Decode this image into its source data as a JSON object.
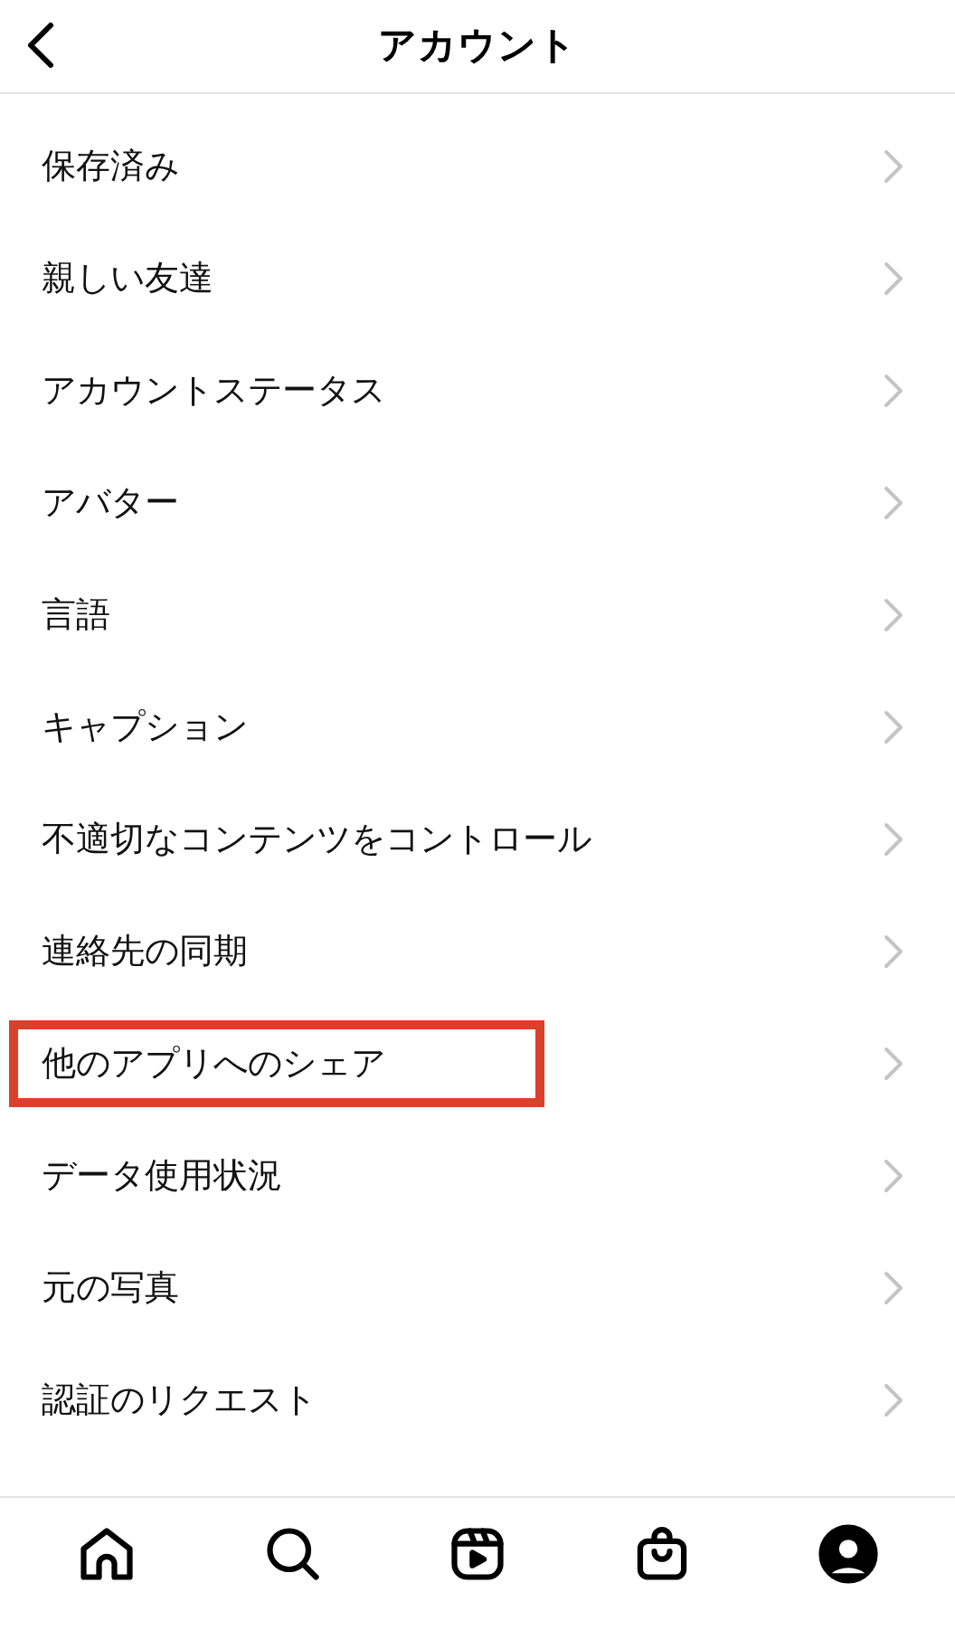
{
  "header": {
    "title": "アカウント"
  },
  "items": [
    {
      "label": "保存済み",
      "highlighted": false
    },
    {
      "label": "親しい友達",
      "highlighted": false
    },
    {
      "label": "アカウントステータス",
      "highlighted": false
    },
    {
      "label": "アバター",
      "highlighted": false
    },
    {
      "label": "言語",
      "highlighted": false
    },
    {
      "label": "キャプション",
      "highlighted": false
    },
    {
      "label": "不適切なコンテンツをコントロール",
      "highlighted": false
    },
    {
      "label": "連絡先の同期",
      "highlighted": false
    },
    {
      "label": "他のアプリへのシェア",
      "highlighted": true
    },
    {
      "label": "データ使用状況",
      "highlighted": false
    },
    {
      "label": "元の写真",
      "highlighted": false
    },
    {
      "label": "認証のリクエスト",
      "highlighted": false
    }
  ],
  "tab_bar": [
    {
      "kind": "home",
      "selected": false
    },
    {
      "kind": "search",
      "selected": false
    },
    {
      "kind": "reels",
      "selected": false
    },
    {
      "kind": "shop",
      "selected": false
    },
    {
      "kind": "profile",
      "selected": true
    }
  ]
}
